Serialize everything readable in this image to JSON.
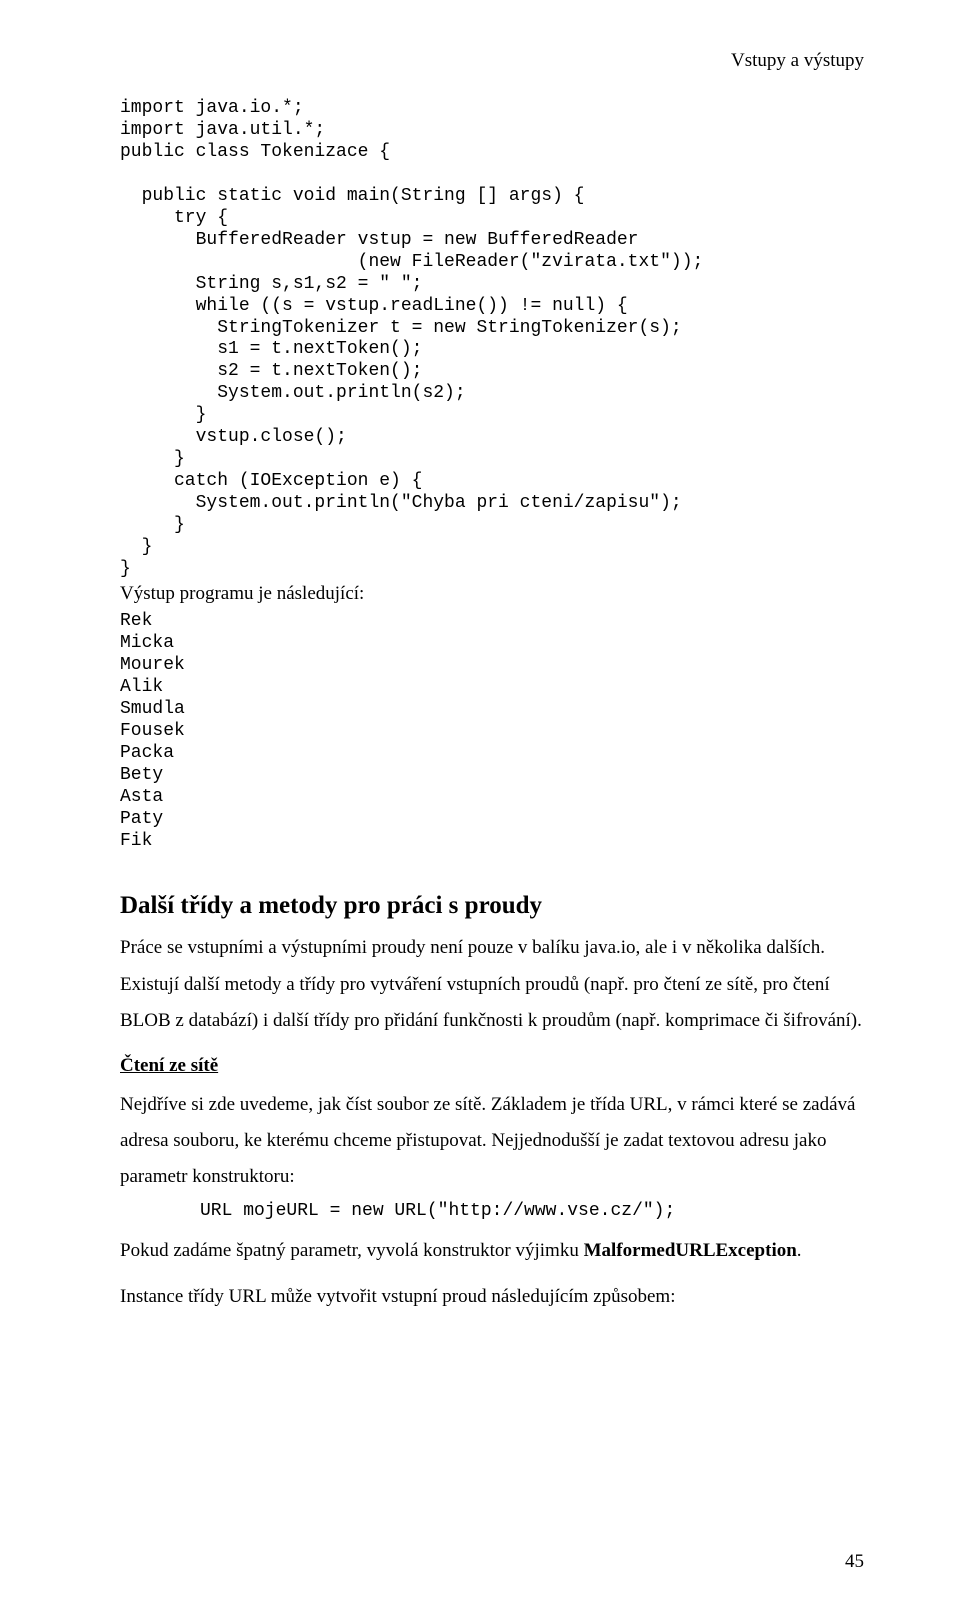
{
  "header": "Vstupy a výstupy",
  "code_block": "import java.io.*;\nimport java.util.*;\npublic class Tokenizace {\n\n  public static void main(String [] args) {\n     try {\n       BufferedReader vstup = new BufferedReader\n                      (new FileReader(\"zvirata.txt\"));\n       String s,s1,s2 = \" \";\n       while ((s = vstup.readLine()) != null) {\n         StringTokenizer t = new StringTokenizer(s);\n         s1 = t.nextToken();\n         s2 = t.nextToken();\n         System.out.println(s2);\n       }\n       vstup.close();\n     }\n     catch (IOException e) {\n       System.out.println(\"Chyba pri cteni/zapisu\");\n     }\n  }\n}",
  "output_intro": "Výstup programu je následující:",
  "output_block": "Rek\nMicka\nMourek\nAlik\nSmudla\nFousek\nPacka\nBety\nAsta\nPaty\nFik",
  "section_title": "Další třídy a metody pro práci s proudy",
  "para1": "Práce se vstupními a výstupními proudy není pouze v balíku java.io, ale i v několika dalších. Existují další metody a třídy pro vytváření vstupních proudů (např. pro čtení ze sítě, pro čtení BLOB z databází) i další třídy pro přidání funkčnosti k proudům (např. komprimace či šifrování).",
  "subsection_title": "Čtení ze sítě",
  "para2": "Nejdříve si zde uvedeme, jak číst soubor ze sítě. Základem je třída URL, v rámci které se zadává adresa souboru, ke kterému chceme přistupovat. Nejjednodušší je zadat textovou adresu jako parametr konstruktoru:",
  "url_line": "URL mojeURL = new URL(\"http://www.vse.cz/\");",
  "para3_pre": "Pokud zadáme špatný parametr, vyvolá konstruktor výjimku ",
  "para3_bold": "MalformedURLException",
  "para3_post": ".",
  "para4": "Instance třídy URL může vytvořit vstupní proud následujícím způsobem:",
  "page_number": "45"
}
